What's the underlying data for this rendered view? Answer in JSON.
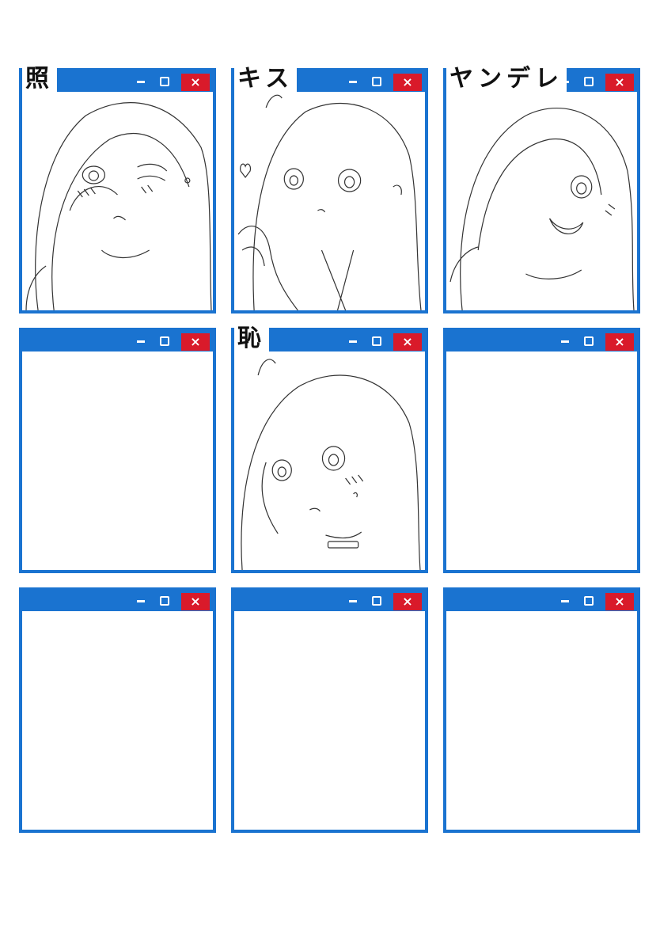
{
  "windows": [
    {
      "title": "照",
      "has_art": true,
      "art": "sketch-girl-blushing-wink"
    },
    {
      "title": "キス",
      "has_art": true,
      "art": "sketch-girl-hands-together"
    },
    {
      "title": "ヤンデレ",
      "has_art": true,
      "art": "sketch-girl-smiling-hair-covering-eye"
    },
    {
      "title": "",
      "has_art": false
    },
    {
      "title": "恥",
      "has_art": true,
      "art": "sketch-girl-embarrassed"
    },
    {
      "title": "",
      "has_art": false
    },
    {
      "title": "",
      "has_art": false
    },
    {
      "title": "",
      "has_art": false
    },
    {
      "title": "",
      "has_art": false
    }
  ],
  "controls": {
    "minimize_icon": "minimize-icon",
    "maximize_icon": "maximize-icon",
    "close_label": "×"
  },
  "colors": {
    "frame": "#1a73d0",
    "close": "#d91a2a",
    "background": "#ffffff"
  }
}
